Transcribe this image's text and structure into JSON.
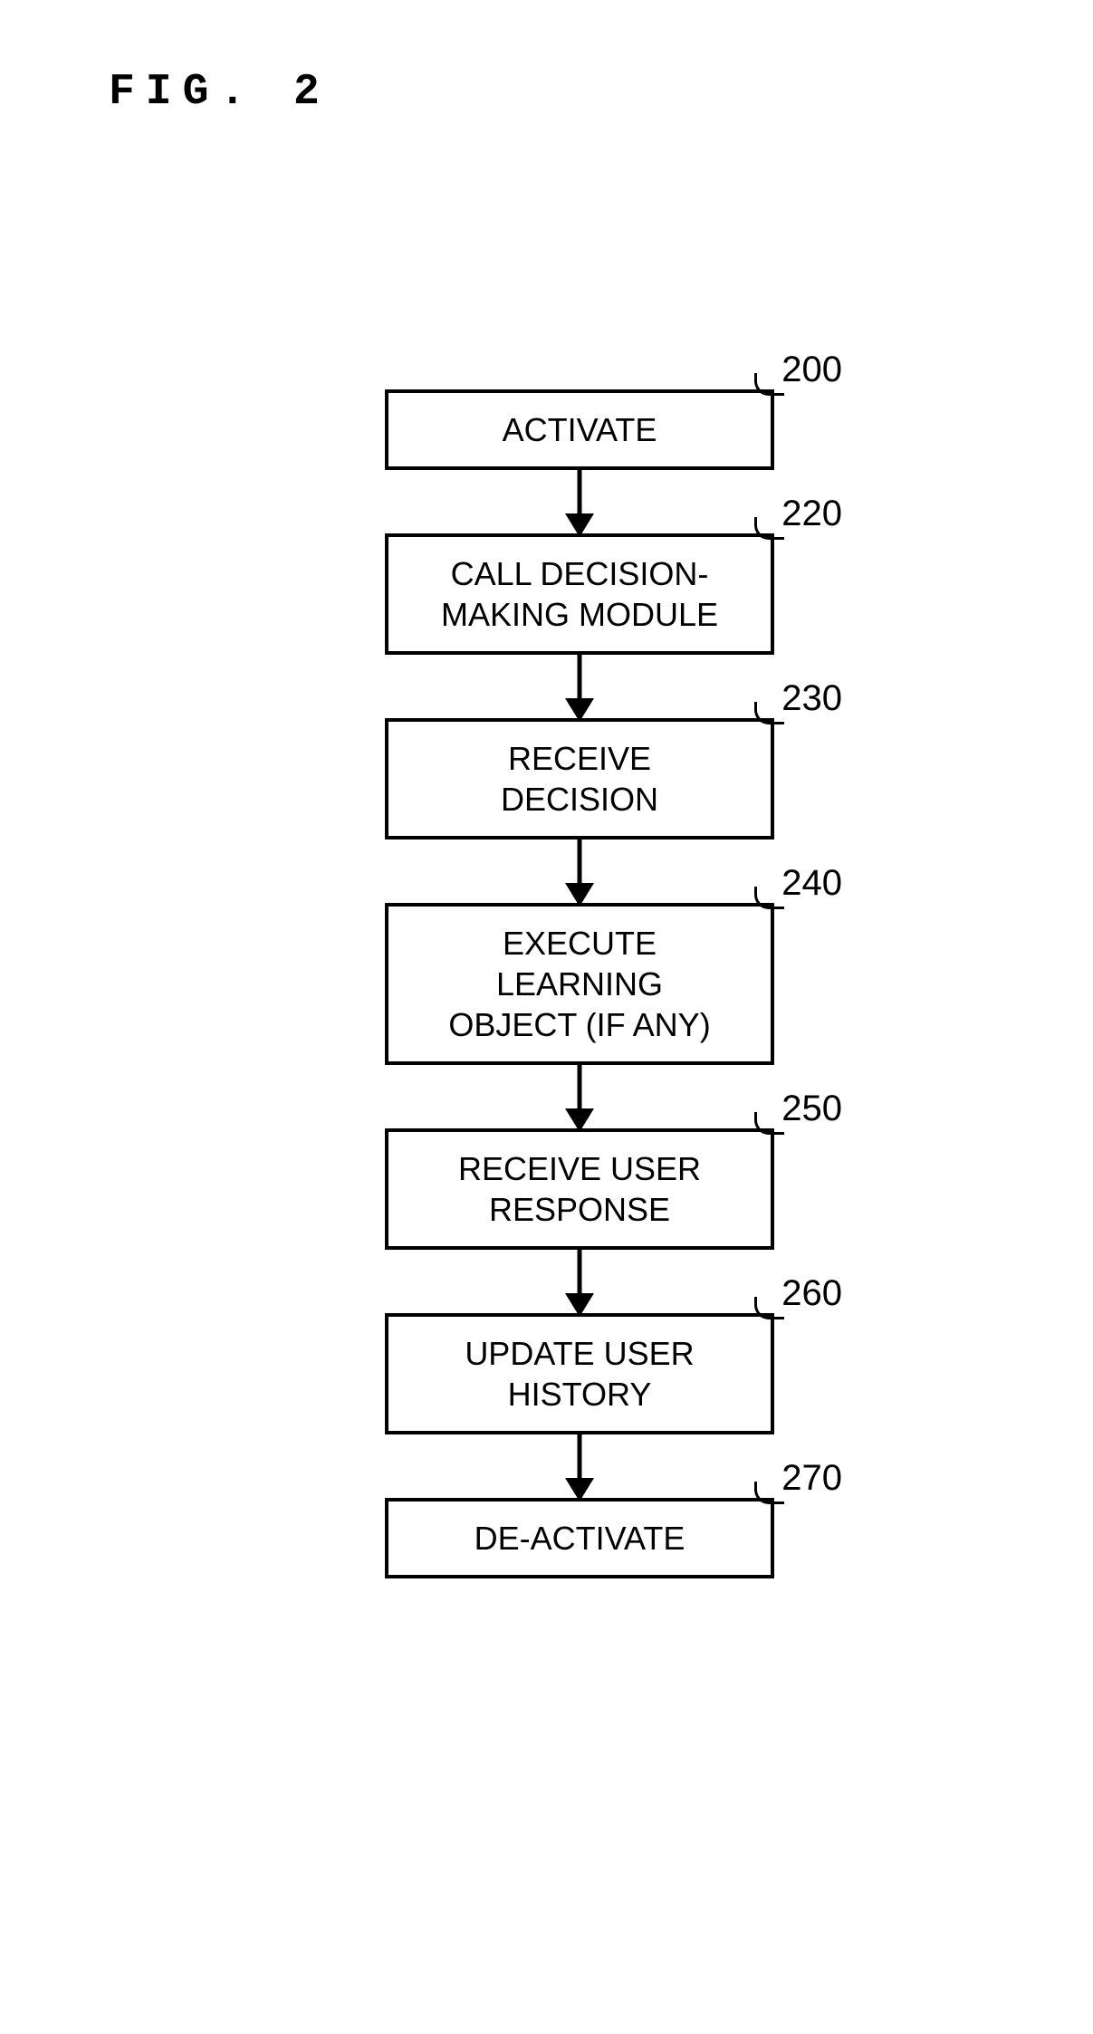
{
  "figure_label": "FIG. 2",
  "steps": [
    {
      "ref": "200",
      "text": "ACTIVATE"
    },
    {
      "ref": "220",
      "text": "CALL DECISION-\nMAKING MODULE"
    },
    {
      "ref": "230",
      "text": "RECEIVE\nDECISION"
    },
    {
      "ref": "240",
      "text": "EXECUTE\nLEARNING\nOBJECT (IF ANY)"
    },
    {
      "ref": "250",
      "text": "RECEIVE USER\nRESPONSE"
    },
    {
      "ref": "260",
      "text": "UPDATE USER\nHISTORY"
    },
    {
      "ref": "270",
      "text": "DE-ACTIVATE"
    }
  ]
}
